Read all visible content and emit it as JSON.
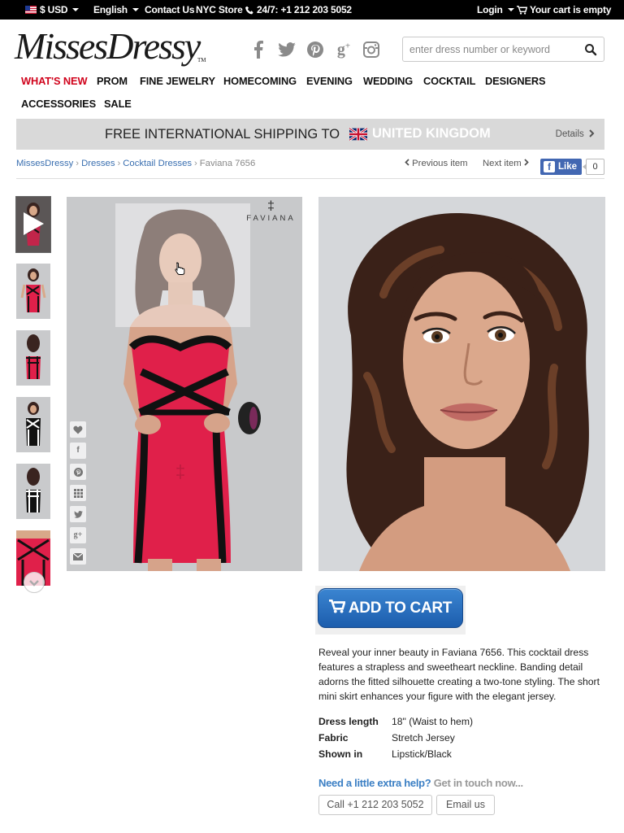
{
  "topbar": {
    "currency": "$ USD",
    "language": "English",
    "contact": "Contact Us",
    "store": "NYC Store",
    "phone": "24/7: +1 212 203 5052",
    "login": "Login",
    "cart": "Your cart is empty"
  },
  "header": {
    "logo": "MissesDressy",
    "logo_tm": "TM",
    "search_placeholder": "enter dress number or keyword",
    "social": [
      "facebook-icon",
      "twitter-icon",
      "pinterest-icon",
      "google-plus-icon",
      "instagram-icon"
    ]
  },
  "nav": {
    "items": [
      "WHAT'S NEW",
      "PROM",
      "FINE JEWELRY",
      "HOMECOMING",
      "EVENING",
      "WEDDING",
      "COCKTAIL",
      "DESIGNERS",
      "ACCESSORIES",
      "SALE"
    ],
    "active_color": "#d0021b"
  },
  "shipping": {
    "text": "FREE INTERNATIONAL SHIPPING TO",
    "country": "UNITED KINGDOM",
    "details": "Details"
  },
  "breadcrumb": {
    "items": [
      "MissesDressy",
      "Dresses",
      "Cocktail Dresses"
    ],
    "current": "Faviana 7656",
    "previous": "Previous item",
    "next": "Next item",
    "like": "Like",
    "like_count": "0"
  },
  "product": {
    "brand_logo": "FAVIANA",
    "add_to_cart": "ADD TO CART",
    "description": "Reveal your inner beauty in Faviana 7656. This cocktail dress features a strapless and sweetheart neckline. Banding detail adorns the fitted silhouette creating a two-tone styling. The short mini skirt enhances your figure with the elegant jersey.",
    "specs": [
      {
        "label": "Dress length",
        "value": "18\" (Waist to hem)"
      },
      {
        "label": "Fabric",
        "value": "Stretch Jersey"
      },
      {
        "label": "Shown in",
        "value": "Lipstick/Black"
      }
    ],
    "colors": {
      "dress": "#e0204a",
      "trim": "#111111",
      "button": "#2a6fc0"
    }
  },
  "help": {
    "question": "Need a little extra help?",
    "tagline": "Get in touch now...",
    "call": "Call +1 212 203 5052",
    "email": "Email us"
  }
}
